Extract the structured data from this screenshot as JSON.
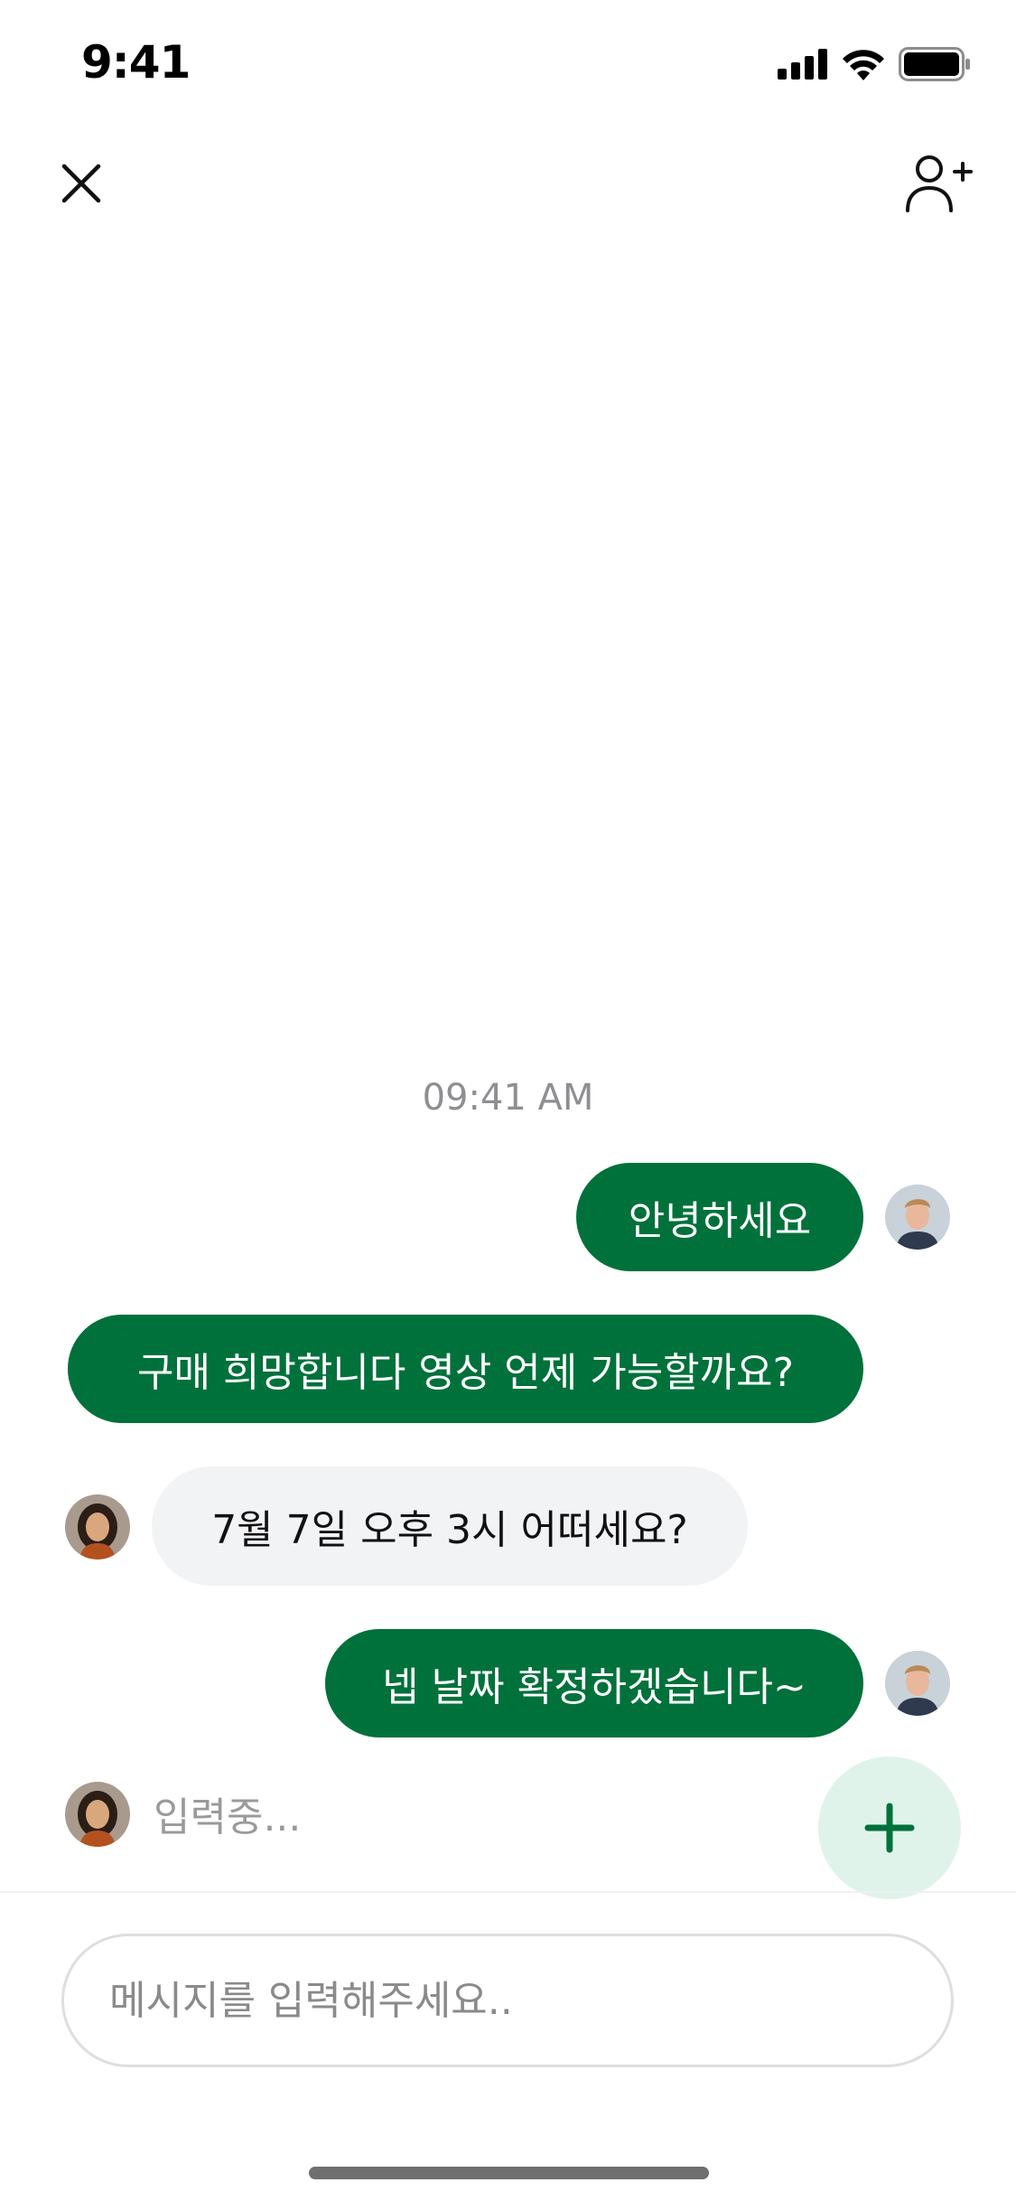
{
  "status_bar": {
    "time": "9:41",
    "icons": [
      "signal-icon",
      "wifi-icon",
      "battery-icon"
    ]
  },
  "header": {
    "close_icon": "close-icon",
    "add_user_icon": "add-user-icon"
  },
  "chat": {
    "timestamp": "09:41 AM",
    "messages": [
      {
        "direction": "outgoing",
        "text": "안녕하세요",
        "avatar": true
      },
      {
        "direction": "outgoing",
        "text": "구매 희망합니다 영상 언제 가능할까요?",
        "avatar": false
      },
      {
        "direction": "incoming",
        "text": "7월 7일 오후 3시 어떠세요?",
        "avatar": true
      },
      {
        "direction": "outgoing",
        "text": "넵 날짜 확정하겠습니다~",
        "avatar": true
      }
    ],
    "typing_indicator": "입력중..."
  },
  "composer": {
    "placeholder": "메시지를 입력해주세요..",
    "value": "",
    "add_icon": "plus-icon"
  },
  "colors": {
    "outgoing_bubble": "#00713b",
    "incoming_bubble": "#f2f3f5",
    "fab_background": "#dff3ea",
    "accent": "#00713b"
  }
}
